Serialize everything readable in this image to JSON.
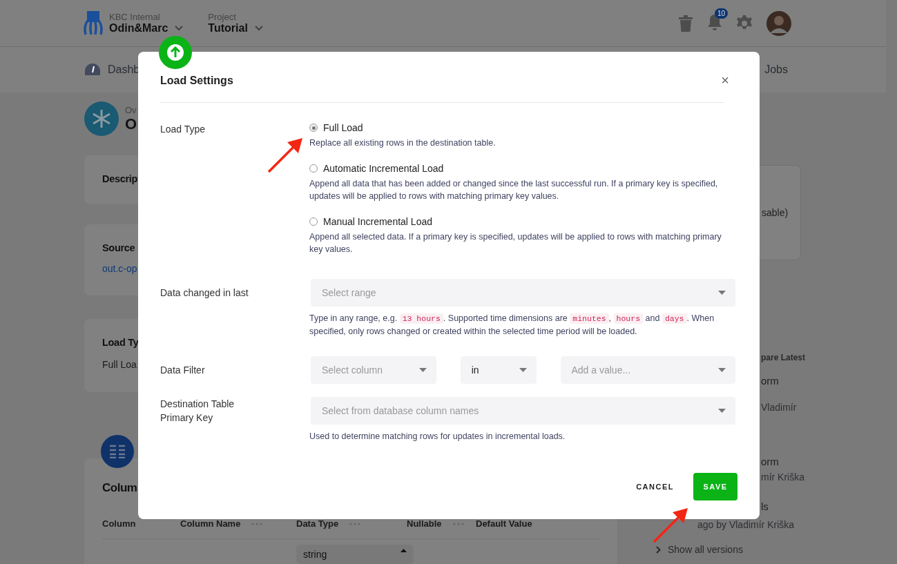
{
  "header": {
    "org_label": "KBC Internal",
    "org_name": "Odin&Marc",
    "project_label": "Project",
    "project_name": "Tutorial",
    "notification_count": "10"
  },
  "nav": [
    {
      "label": "Dashb",
      "kind": "dashboard"
    },
    {
      "label": "Jobs",
      "kind": "plain"
    }
  ],
  "page": {
    "overline": "Ov",
    "title": "O"
  },
  "cards": [
    {
      "title": "Descrip"
    },
    {
      "title": "Source",
      "link": "out.c-op"
    },
    {
      "title": "Load Ty",
      "value": "Full Loa"
    }
  ],
  "columns_section": {
    "title": "Colum",
    "headers": [
      {
        "label": "Column",
        "menu": false
      },
      {
        "label": "Column Name",
        "menu": true
      },
      {
        "label": "Data Type",
        "menu": true
      },
      {
        "label": "Nullable",
        "menu": true
      },
      {
        "label": "Default Value",
        "menu": false
      }
    ],
    "type_value": "string"
  },
  "sidebar": {
    "card_text": "sable)",
    "versions_heading": "pare Latest",
    "versions": [
      {
        "title": "orm",
        "meta": "Vladimír"
      },
      {
        "title": "orm",
        "meta": "mír Kriška"
      },
      {
        "title": "ls",
        "meta": "ago by Vladimír Kriška"
      }
    ],
    "show_all": "Show all versions"
  },
  "modal": {
    "title": "Load Settings",
    "close": "×",
    "load_type": {
      "label": "Load Type",
      "options": [
        {
          "label": "Full Load",
          "description": "Replace all existing rows in the destination table.",
          "selected": true
        },
        {
          "label": "Automatic Incremental Load",
          "description": "Append all data that has been added or changed since the last successful run. If a primary key is specified, updates will be applied to rows with matching primary key values.",
          "selected": false
        },
        {
          "label": "Manual Incremental Load",
          "description": "Append all selected data. If a primary key is specified, updates will be applied to rows with matching primary key values.",
          "selected": false
        }
      ]
    },
    "data_changed": {
      "label": "Data changed in last",
      "placeholder": "Select range",
      "help": [
        {
          "kind": "text",
          "text": "Type in any range, e.g. "
        },
        {
          "kind": "code",
          "text": "13 hours"
        },
        {
          "kind": "text",
          "text": ". Supported time dimensions are "
        },
        {
          "kind": "code",
          "text": "minutes"
        },
        {
          "kind": "text",
          "text": ", "
        },
        {
          "kind": "code",
          "text": "hours"
        },
        {
          "kind": "text",
          "text": " and "
        },
        {
          "kind": "code",
          "text": "days"
        },
        {
          "kind": "text",
          "text": ". When specified, only rows changed or created within the selected time period will be loaded."
        }
      ]
    },
    "data_filter": {
      "label": "Data Filter",
      "column_placeholder": "Select column",
      "operator": "in",
      "value_placeholder": "Add a value..."
    },
    "primary_key": {
      "label": "Destination Table Primary Key",
      "placeholder": "Select from database column names",
      "help": "Used to determine matching rows for updates in incremental loads."
    },
    "buttons": {
      "cancel": "CANCEL",
      "save": "SAVE"
    }
  }
}
